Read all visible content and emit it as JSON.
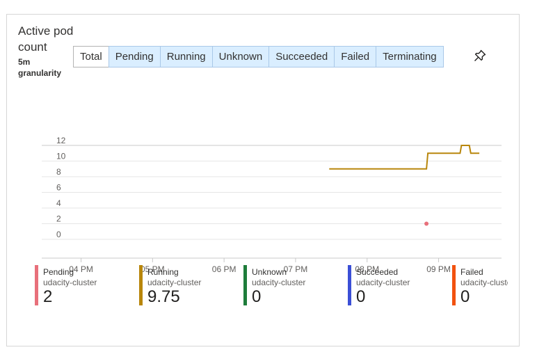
{
  "card": {
    "title": "Active pod count",
    "granularity": "5m granularity",
    "pin_icon": "pin-icon"
  },
  "tabs": [
    {
      "label": "Total",
      "selected": true
    },
    {
      "label": "Pending",
      "selected": false
    },
    {
      "label": "Running",
      "selected": false
    },
    {
      "label": "Unknown",
      "selected": false
    },
    {
      "label": "Succeeded",
      "selected": false
    },
    {
      "label": "Failed",
      "selected": false
    },
    {
      "label": "Terminating",
      "selected": false
    }
  ],
  "legend": [
    {
      "name": "Pending",
      "sub": "udacity-cluster",
      "value": "2",
      "color": "#e8707b"
    },
    {
      "name": "Running",
      "sub": "udacity-cluster",
      "value": "9.75",
      "color": "#b8860b"
    },
    {
      "name": "Unknown",
      "sub": "udacity-cluster",
      "value": "0",
      "color": "#1e7d3b"
    },
    {
      "name": "Succeeded",
      "sub": "udacity-cluster",
      "value": "0",
      "color": "#3b4fd6"
    },
    {
      "name": "Failed",
      "sub": "udacity-cluster",
      "value": "0",
      "color": "#f2520f"
    }
  ],
  "chart_data": {
    "type": "line",
    "title": "",
    "xlabel": "",
    "ylabel": "",
    "ylim": [
      0,
      12
    ],
    "yticks": [
      "0",
      "2",
      "4",
      "6",
      "8",
      "10",
      "12"
    ],
    "xticks": [
      "04 PM",
      "05 PM",
      "06 PM",
      "07 PM",
      "08 PM",
      "09 PM"
    ],
    "xlim": [
      15.45,
      21.88
    ],
    "grid": true,
    "series": [
      {
        "name": "Running",
        "color": "#b8860b",
        "step": true,
        "x": [
          19.47,
          20.83,
          20.85,
          21.3,
          21.32,
          21.43,
          21.45,
          21.57
        ],
        "y": [
          9,
          9,
          11,
          11,
          12,
          12,
          11,
          11
        ]
      },
      {
        "name": "Pending",
        "color": "#e8707b",
        "marker": true,
        "x": [
          20.83
        ],
        "y": [
          2
        ]
      }
    ]
  }
}
